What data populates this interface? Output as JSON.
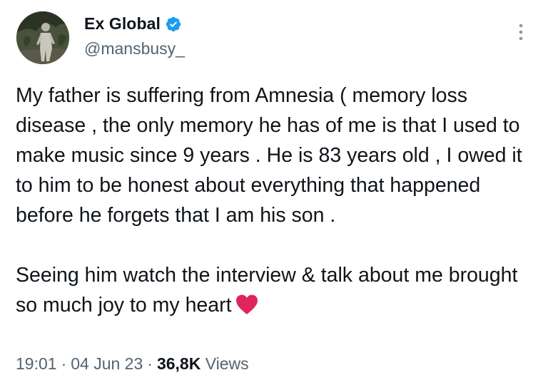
{
  "author": {
    "display_name": "Ex Global",
    "handle": "@mansbusy_",
    "verified_icon": "verified-badge-icon",
    "verified_color": "#1d9bf0"
  },
  "tweet": {
    "paragraph_1": "My father is suffering from Amnesia ( memory loss disease , the only memory he has of me is that I used to make music since 9 years . He is 83 years old , I owed it to him to be honest about everything that happened before he forgets that I am his son .",
    "paragraph_2": "Seeing him watch the interview & talk about me brought so much joy to my heart",
    "emoji_icon": "red-heart-icon",
    "emoji_color": "#e0245e"
  },
  "meta": {
    "time": "19:01",
    "date": "04 Jun 23",
    "views_count": "36,8K",
    "views_label": "Views",
    "separator": "·"
  },
  "more_icon": "more-vertical-icon"
}
